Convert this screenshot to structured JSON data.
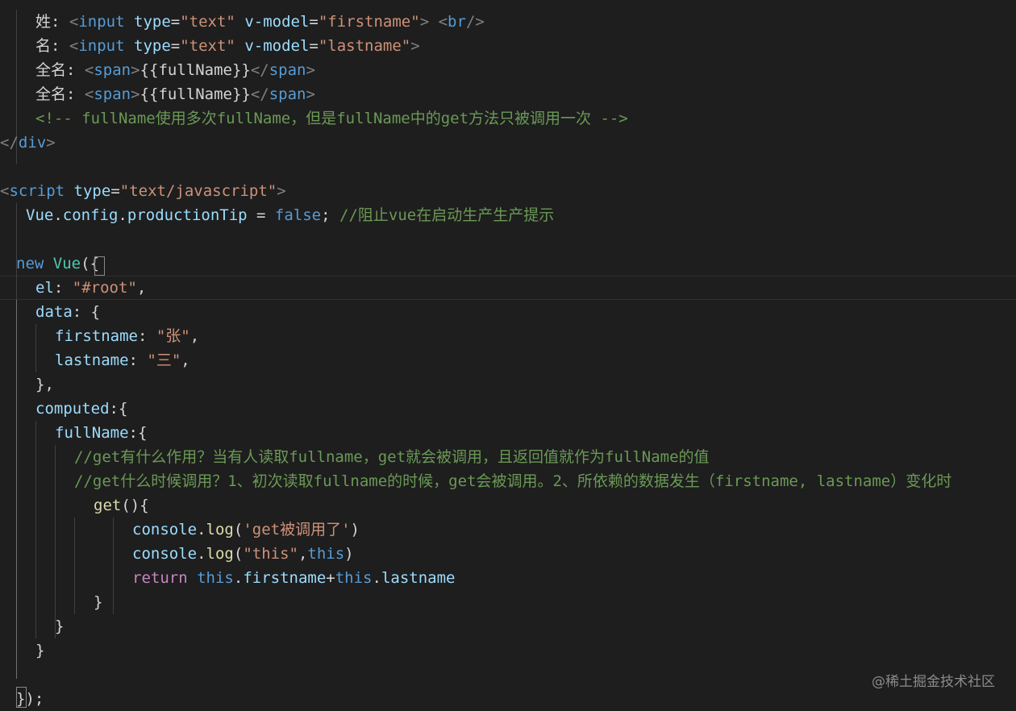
{
  "editor": {
    "theme_colors": {
      "background": "#1e1e1e",
      "tag_punct": "#808080",
      "tag_name": "#569cd6",
      "attribute": "#9cdcfe",
      "string": "#ce9178",
      "plain": "#d4d4d4",
      "comment": "#6a9955",
      "keyword": "#569cd6",
      "control": "#c586c0",
      "class": "#4ec9b0",
      "function": "#dcdcaa"
    },
    "lines": [
      {
        "name": "line-firstname-input",
        "tokens": [
          {
            "t": "姓: ",
            "c": "plain"
          },
          {
            "t": "<",
            "c": "tag_punct"
          },
          {
            "t": "input",
            "c": "tag_name"
          },
          {
            "t": " ",
            "c": "plain"
          },
          {
            "t": "type",
            "c": "attribute"
          },
          {
            "t": "=",
            "c": "plain"
          },
          {
            "t": "\"text\"",
            "c": "string"
          },
          {
            "t": " ",
            "c": "plain"
          },
          {
            "t": "v-model",
            "c": "attribute"
          },
          {
            "t": "=",
            "c": "plain"
          },
          {
            "t": "\"firstname\"",
            "c": "string"
          },
          {
            "t": ">",
            "c": "tag_punct"
          },
          {
            "t": " ",
            "c": "plain"
          },
          {
            "t": "<",
            "c": "tag_punct"
          },
          {
            "t": "br",
            "c": "tag_name"
          },
          {
            "t": "/>",
            "c": "tag_punct"
          }
        ]
      },
      {
        "name": "line-lastname-input",
        "tokens": [
          {
            "t": "名: ",
            "c": "plain"
          },
          {
            "t": "<",
            "c": "tag_punct"
          },
          {
            "t": "input",
            "c": "tag_name"
          },
          {
            "t": " ",
            "c": "plain"
          },
          {
            "t": "type",
            "c": "attribute"
          },
          {
            "t": "=",
            "c": "plain"
          },
          {
            "t": "\"text\"",
            "c": "string"
          },
          {
            "t": " ",
            "c": "plain"
          },
          {
            "t": "v-model",
            "c": "attribute"
          },
          {
            "t": "=",
            "c": "plain"
          },
          {
            "t": "\"lastname\"",
            "c": "string"
          },
          {
            "t": ">",
            "c": "tag_punct"
          }
        ]
      },
      {
        "name": "line-fullname-span-1",
        "tokens": [
          {
            "t": "全名: ",
            "c": "plain"
          },
          {
            "t": "<",
            "c": "tag_punct"
          },
          {
            "t": "span",
            "c": "tag_name"
          },
          {
            "t": ">",
            "c": "tag_punct"
          },
          {
            "t": "{{fullName}}",
            "c": "plain"
          },
          {
            "t": "</",
            "c": "tag_punct"
          },
          {
            "t": "span",
            "c": "tag_name"
          },
          {
            "t": ">",
            "c": "tag_punct"
          }
        ]
      },
      {
        "name": "line-fullname-span-2",
        "tokens": [
          {
            "t": "全名: ",
            "c": "plain"
          },
          {
            "t": "<",
            "c": "tag_punct"
          },
          {
            "t": "span",
            "c": "tag_name"
          },
          {
            "t": ">",
            "c": "tag_punct"
          },
          {
            "t": "{{fullName}}",
            "c": "plain"
          },
          {
            "t": "</",
            "c": "tag_punct"
          },
          {
            "t": "span",
            "c": "tag_name"
          },
          {
            "t": ">",
            "c": "tag_punct"
          }
        ]
      },
      {
        "name": "line-html-comment",
        "tokens": [
          {
            "t": "<!-- fullName使用多次fullName，但是fullName中的get方法只被调用一次 -->",
            "c": "comment"
          }
        ]
      },
      {
        "name": "line-div-close",
        "tokens": [
          {
            "t": "</",
            "c": "tag_punct"
          },
          {
            "t": "div",
            "c": "tag_name"
          },
          {
            "t": ">",
            "c": "tag_punct"
          }
        ]
      },
      {
        "name": "line-empty-1",
        "tokens": []
      },
      {
        "name": "line-script-open",
        "tokens": [
          {
            "t": "<",
            "c": "tag_punct"
          },
          {
            "t": "script",
            "c": "tag_name"
          },
          {
            "t": " ",
            "c": "plain"
          },
          {
            "t": "type",
            "c": "attribute"
          },
          {
            "t": "=",
            "c": "plain"
          },
          {
            "t": "\"text/javascript\"",
            "c": "string"
          },
          {
            "t": ">",
            "c": "tag_punct"
          }
        ]
      },
      {
        "name": "line-production-tip",
        "tokens": [
          {
            "t": "Vue",
            "c": "attribute"
          },
          {
            "t": ".",
            "c": "plain"
          },
          {
            "t": "config",
            "c": "attribute"
          },
          {
            "t": ".",
            "c": "plain"
          },
          {
            "t": "productionTip",
            "c": "attribute"
          },
          {
            "t": " = ",
            "c": "plain"
          },
          {
            "t": "false",
            "c": "keyword"
          },
          {
            "t": "; ",
            "c": "plain"
          },
          {
            "t": "//阻止vue在启动生产生产提示",
            "c": "comment"
          }
        ]
      },
      {
        "name": "line-empty-2",
        "tokens": []
      },
      {
        "name": "line-new-vue",
        "tokens": [
          {
            "t": "new",
            "c": "keyword"
          },
          {
            "t": " ",
            "c": "plain"
          },
          {
            "t": "Vue",
            "c": "class"
          },
          {
            "t": "(",
            "c": "plain"
          },
          {
            "t": "{",
            "c": "plain"
          }
        ]
      },
      {
        "name": "line-el",
        "tokens": [
          {
            "t": "el",
            "c": "attribute"
          },
          {
            "t": ": ",
            "c": "plain"
          },
          {
            "t": "\"#root\"",
            "c": "string"
          },
          {
            "t": ",",
            "c": "plain"
          }
        ]
      },
      {
        "name": "line-data-open",
        "tokens": [
          {
            "t": "data",
            "c": "attribute"
          },
          {
            "t": ": {",
            "c": "plain"
          }
        ]
      },
      {
        "name": "line-firstname-prop",
        "tokens": [
          {
            "t": "firstname",
            "c": "attribute"
          },
          {
            "t": ": ",
            "c": "plain"
          },
          {
            "t": "\"张\"",
            "c": "string"
          },
          {
            "t": ",",
            "c": "plain"
          }
        ]
      },
      {
        "name": "line-lastname-prop",
        "tokens": [
          {
            "t": "lastname",
            "c": "attribute"
          },
          {
            "t": ": ",
            "c": "plain"
          },
          {
            "t": "\"三\"",
            "c": "string"
          },
          {
            "t": ",",
            "c": "plain"
          }
        ]
      },
      {
        "name": "line-data-close",
        "tokens": [
          {
            "t": "},",
            "c": "plain"
          }
        ]
      },
      {
        "name": "line-computed-open",
        "tokens": [
          {
            "t": "computed",
            "c": "attribute"
          },
          {
            "t": ":{",
            "c": "plain"
          }
        ]
      },
      {
        "name": "line-fullname-open",
        "tokens": [
          {
            "t": "fullName",
            "c": "attribute"
          },
          {
            "t": ":{",
            "c": "plain"
          }
        ]
      },
      {
        "name": "line-comment-get-purpose",
        "tokens": [
          {
            "t": "//get有什么作用？当有人读取fullname，get就会被调用，且返回值就作为fullName的值",
            "c": "comment"
          }
        ]
      },
      {
        "name": "line-comment-get-when",
        "tokens": [
          {
            "t": "//get什么时候调用？1、初次读取fullname的时候，get会被调用。2、所依赖的数据发生（firstname, lastname）变化时",
            "c": "comment"
          }
        ]
      },
      {
        "name": "line-get-open",
        "tokens": [
          {
            "t": "get",
            "c": "function"
          },
          {
            "t": "(){",
            "c": "plain"
          }
        ]
      },
      {
        "name": "line-console-log-1",
        "tokens": [
          {
            "t": "console",
            "c": "attribute"
          },
          {
            "t": ".",
            "c": "plain"
          },
          {
            "t": "log",
            "c": "function"
          },
          {
            "t": "(",
            "c": "plain"
          },
          {
            "t": "'get被调用了'",
            "c": "string"
          },
          {
            "t": ")",
            "c": "plain"
          }
        ]
      },
      {
        "name": "line-console-log-2",
        "tokens": [
          {
            "t": "console",
            "c": "attribute"
          },
          {
            "t": ".",
            "c": "plain"
          },
          {
            "t": "log",
            "c": "function"
          },
          {
            "t": "(",
            "c": "plain"
          },
          {
            "t": "\"this\"",
            "c": "string"
          },
          {
            "t": ",",
            "c": "plain"
          },
          {
            "t": "this",
            "c": "keyword"
          },
          {
            "t": ")",
            "c": "plain"
          }
        ]
      },
      {
        "name": "line-return",
        "tokens": [
          {
            "t": "return",
            "c": "control"
          },
          {
            "t": " ",
            "c": "plain"
          },
          {
            "t": "this",
            "c": "keyword"
          },
          {
            "t": ".",
            "c": "plain"
          },
          {
            "t": "firstname",
            "c": "attribute"
          },
          {
            "t": "+",
            "c": "plain"
          },
          {
            "t": "this",
            "c": "keyword"
          },
          {
            "t": ".",
            "c": "plain"
          },
          {
            "t": "lastname",
            "c": "attribute"
          }
        ]
      },
      {
        "name": "line-get-close",
        "tokens": [
          {
            "t": "}",
            "c": "plain"
          }
        ]
      },
      {
        "name": "line-fullname-close",
        "tokens": [
          {
            "t": "}",
            "c": "plain"
          }
        ]
      },
      {
        "name": "line-computed-close",
        "tokens": [
          {
            "t": "}",
            "c": "plain"
          }
        ]
      },
      {
        "name": "line-empty-3",
        "tokens": []
      },
      {
        "name": "line-vue-close",
        "tokens": [
          {
            "t": "}",
            "c": "plain"
          },
          {
            "t": ");",
            "c": "plain"
          }
        ]
      }
    ]
  },
  "watermark": "@稀土掘金技术社区"
}
